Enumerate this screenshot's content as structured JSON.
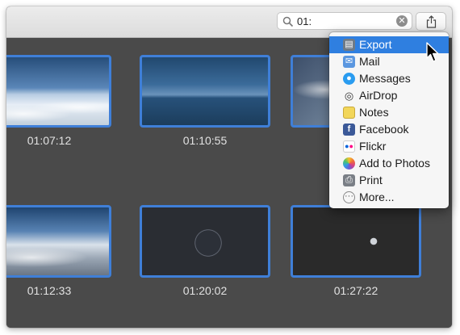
{
  "search": {
    "value": "01:",
    "placeholder": "Search"
  },
  "thumbnails": [
    {
      "time": "01:07:12"
    },
    {
      "time": "01:10:55"
    },
    {
      "time": ""
    },
    {
      "time": "01:12:33"
    },
    {
      "time": "01:20:02"
    },
    {
      "time": "01:27:22"
    }
  ],
  "share_menu": {
    "items": [
      {
        "label": "Export",
        "icon": "export-icon",
        "highlighted": true
      },
      {
        "label": "Mail",
        "icon": "mail-icon"
      },
      {
        "label": "Messages",
        "icon": "messages-icon"
      },
      {
        "label": "AirDrop",
        "icon": "airdrop-icon"
      },
      {
        "label": "Notes",
        "icon": "notes-icon"
      },
      {
        "label": "Facebook",
        "icon": "facebook-icon"
      },
      {
        "label": "Flickr",
        "icon": "flickr-icon"
      },
      {
        "label": "Add to Photos",
        "icon": "photos-icon"
      },
      {
        "label": "Print",
        "icon": "print-icon"
      },
      {
        "label": "More...",
        "icon": "more-icon"
      }
    ]
  },
  "colors": {
    "selection": "#3f7fd8",
    "menu_highlight": "#2f7fe0",
    "content_bg": "#4a4a4a"
  }
}
